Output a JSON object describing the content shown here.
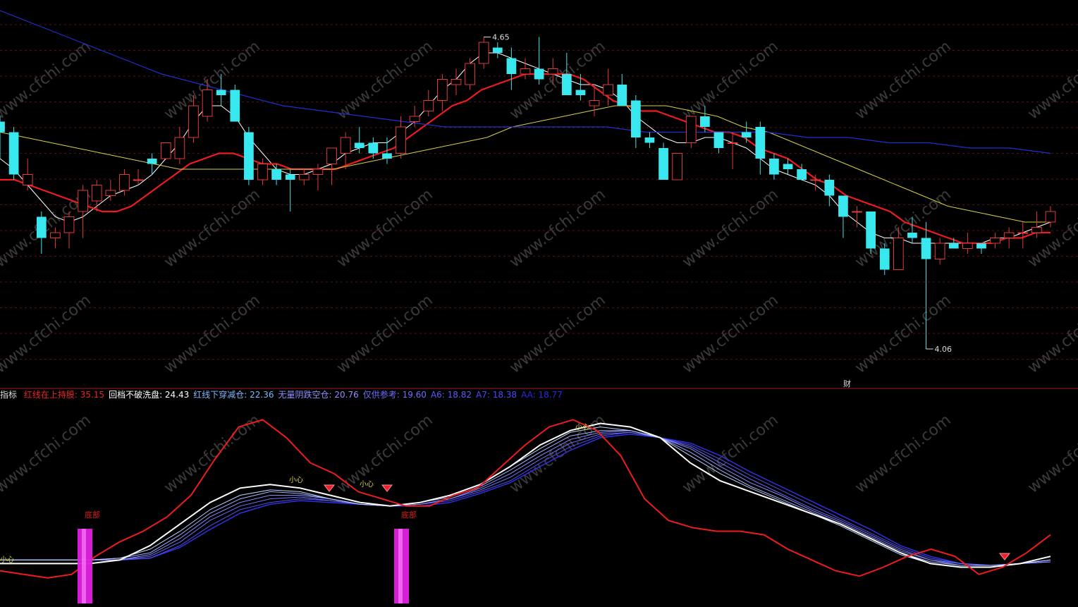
{
  "colors": {
    "background": "#000000",
    "up": "#e23a3a",
    "down": "#38e8ee",
    "ma_white": "#ffffff",
    "ma_red": "#ee1c1c",
    "ma_yellow": "#d6d040",
    "ma_blue": "#2030d0",
    "grid": "#5a1010",
    "divider": "#a02020",
    "bar_magenta": "#e020e0",
    "bottom_marker": "#ee2030"
  },
  "watermark": "www.cfchi.com",
  "price_panel": {
    "high_label": "4.65",
    "low_label": "4.06",
    "cai_label": "财"
  },
  "indicator_legend": {
    "name": "指标",
    "items": [
      {
        "label": "红线在上持股:",
        "value": "35.15",
        "color": "#ee2222"
      },
      {
        "label": "回档不破洗盘:",
        "value": "24.43",
        "color": "#ffffff"
      },
      {
        "label": "红线下穿减仓:",
        "value": "22.36",
        "color": "#7fb8ff"
      },
      {
        "label": "无量阴跌空仓:",
        "value": "20.76",
        "color": "#8f8fff"
      },
      {
        "label": "仅供参考:",
        "value": "19.60",
        "color": "#6f6fff"
      },
      {
        "label": "A6:",
        "value": "18.82",
        "color": "#5a5aff"
      },
      {
        "label": "A7:",
        "value": "18.38",
        "color": "#4a4aff"
      },
      {
        "label": "AA:",
        "value": "18.77",
        "color": "#2a2ae0"
      }
    ]
  },
  "indicator_panel": {
    "bottom_labels": [
      "底部",
      "底部"
    ],
    "small_marker_text": "小心"
  },
  "chart_data": [
    {
      "type": "candlestick",
      "title": "",
      "ylim": [
        4.0,
        4.7
      ],
      "max_marker": 4.65,
      "min_marker": 4.06,
      "candles": [
        {
          "o": 4.49,
          "h": 4.5,
          "l": 4.42,
          "c": 4.47
        },
        {
          "o": 4.47,
          "h": 4.48,
          "l": 4.38,
          "c": 4.39
        },
        {
          "o": 4.37,
          "h": 4.42,
          "l": 4.36,
          "c": 4.39
        },
        {
          "o": 4.31,
          "h": 4.32,
          "l": 4.24,
          "c": 4.27
        },
        {
          "o": 4.27,
          "h": 4.29,
          "l": 4.25,
          "c": 4.28
        },
        {
          "o": 4.28,
          "h": 4.32,
          "l": 4.25,
          "c": 4.31
        },
        {
          "o": 4.32,
          "h": 4.37,
          "l": 4.27,
          "c": 4.36
        },
        {
          "o": 4.34,
          "h": 4.38,
          "l": 4.32,
          "c": 4.37
        },
        {
          "o": 4.35,
          "h": 4.38,
          "l": 4.34,
          "c": 4.36
        },
        {
          "o": 4.36,
          "h": 4.4,
          "l": 4.35,
          "c": 4.39
        },
        {
          "o": 4.38,
          "h": 4.4,
          "l": 4.37,
          "c": 4.38
        },
        {
          "o": 4.42,
          "h": 4.43,
          "l": 4.39,
          "c": 4.41
        },
        {
          "o": 4.42,
          "h": 4.45,
          "l": 4.42,
          "c": 4.45
        },
        {
          "o": 4.42,
          "h": 4.48,
          "l": 4.41,
          "c": 4.46
        },
        {
          "o": 4.46,
          "h": 4.54,
          "l": 4.45,
          "c": 4.52
        },
        {
          "o": 4.5,
          "h": 4.57,
          "l": 4.49,
          "c": 4.55
        },
        {
          "o": 4.55,
          "h": 4.58,
          "l": 4.52,
          "c": 4.54
        },
        {
          "o": 4.55,
          "h": 4.56,
          "l": 4.51,
          "c": 4.49
        },
        {
          "o": 4.47,
          "h": 4.48,
          "l": 4.37,
          "c": 4.38
        },
        {
          "o": 4.38,
          "h": 4.42,
          "l": 4.37,
          "c": 4.41
        },
        {
          "o": 4.4,
          "h": 4.41,
          "l": 4.37,
          "c": 4.38
        },
        {
          "o": 4.39,
          "h": 4.4,
          "l": 4.32,
          "c": 4.38
        },
        {
          "o": 4.38,
          "h": 4.4,
          "l": 4.37,
          "c": 4.39
        },
        {
          "o": 4.39,
          "h": 4.41,
          "l": 4.36,
          "c": 4.4
        },
        {
          "o": 4.41,
          "h": 4.44,
          "l": 4.37,
          "c": 4.44
        },
        {
          "o": 4.43,
          "h": 4.47,
          "l": 4.4,
          "c": 4.46
        },
        {
          "o": 4.45,
          "h": 4.48,
          "l": 4.43,
          "c": 4.44
        },
        {
          "o": 4.45,
          "h": 4.46,
          "l": 4.42,
          "c": 4.43
        },
        {
          "o": 4.43,
          "h": 4.46,
          "l": 4.41,
          "c": 4.42
        },
        {
          "o": 4.43,
          "h": 4.5,
          "l": 4.42,
          "c": 4.48
        },
        {
          "o": 4.49,
          "h": 4.52,
          "l": 4.48,
          "c": 4.5
        },
        {
          "o": 4.51,
          "h": 4.55,
          "l": 4.5,
          "c": 4.53
        },
        {
          "o": 4.53,
          "h": 4.58,
          "l": 4.51,
          "c": 4.57
        },
        {
          "o": 4.56,
          "h": 4.59,
          "l": 4.54,
          "c": 4.57
        },
        {
          "o": 4.56,
          "h": 4.61,
          "l": 4.55,
          "c": 4.6
        },
        {
          "o": 4.6,
          "h": 4.65,
          "l": 4.59,
          "c": 4.64
        },
        {
          "o": 4.63,
          "h": 4.64,
          "l": 4.61,
          "c": 4.62
        },
        {
          "o": 4.61,
          "h": 4.63,
          "l": 4.55,
          "c": 4.58
        },
        {
          "o": 4.58,
          "h": 4.61,
          "l": 4.57,
          "c": 4.59
        },
        {
          "o": 4.59,
          "h": 4.65,
          "l": 4.56,
          "c": 4.57
        },
        {
          "o": 4.58,
          "h": 4.61,
          "l": 4.56,
          "c": 4.59
        },
        {
          "o": 4.58,
          "h": 4.62,
          "l": 4.55,
          "c": 4.54
        },
        {
          "o": 4.55,
          "h": 4.58,
          "l": 4.53,
          "c": 4.54
        },
        {
          "o": 4.52,
          "h": 4.56,
          "l": 4.5,
          "c": 4.53
        },
        {
          "o": 4.54,
          "h": 4.59,
          "l": 4.52,
          "c": 4.56
        },
        {
          "o": 4.56,
          "h": 4.58,
          "l": 4.52,
          "c": 4.52
        },
        {
          "o": 4.53,
          "h": 4.54,
          "l": 4.44,
          "c": 4.46
        },
        {
          "o": 4.46,
          "h": 4.47,
          "l": 4.44,
          "c": 4.45
        },
        {
          "o": 4.44,
          "h": 4.45,
          "l": 4.38,
          "c": 4.38
        },
        {
          "o": 4.38,
          "h": 4.43,
          "l": 4.38,
          "c": 4.43
        },
        {
          "o": 4.45,
          "h": 4.5,
          "l": 4.44,
          "c": 4.5
        },
        {
          "o": 4.5,
          "h": 4.52,
          "l": 4.47,
          "c": 4.48
        },
        {
          "o": 4.47,
          "h": 4.47,
          "l": 4.43,
          "c": 4.44
        },
        {
          "o": 4.45,
          "h": 4.47,
          "l": 4.4,
          "c": 4.45
        },
        {
          "o": 4.47,
          "h": 4.49,
          "l": 4.45,
          "c": 4.46
        },
        {
          "o": 4.48,
          "h": 4.49,
          "l": 4.39,
          "c": 4.42
        },
        {
          "o": 4.42,
          "h": 4.43,
          "l": 4.38,
          "c": 4.39
        },
        {
          "o": 4.41,
          "h": 4.42,
          "l": 4.39,
          "c": 4.4
        },
        {
          "o": 4.4,
          "h": 4.41,
          "l": 4.38,
          "c": 4.38
        },
        {
          "o": 4.38,
          "h": 4.39,
          "l": 4.36,
          "c": 4.38
        },
        {
          "o": 4.38,
          "h": 4.39,
          "l": 4.33,
          "c": 4.35
        },
        {
          "o": 4.35,
          "h": 4.35,
          "l": 4.27,
          "c": 4.31
        },
        {
          "o": 4.32,
          "h": 4.33,
          "l": 4.29,
          "c": 4.32
        },
        {
          "o": 4.32,
          "h": 4.32,
          "l": 4.24,
          "c": 4.25
        },
        {
          "o": 4.25,
          "h": 4.26,
          "l": 4.2,
          "c": 4.21
        },
        {
          "o": 4.21,
          "h": 4.29,
          "l": 4.21,
          "c": 4.27
        },
        {
          "o": 4.28,
          "h": 4.31,
          "l": 4.26,
          "c": 4.27
        },
        {
          "o": 4.27,
          "h": 4.3,
          "l": 4.06,
          "c": 4.23
        },
        {
          "o": 4.23,
          "h": 4.27,
          "l": 4.22,
          "c": 4.26
        },
        {
          "o": 4.26,
          "h": 4.27,
          "l": 4.25,
          "c": 4.25
        },
        {
          "o": 4.25,
          "h": 4.28,
          "l": 4.24,
          "c": 4.26
        },
        {
          "o": 4.26,
          "h": 4.26,
          "l": 4.24,
          "c": 4.25
        },
        {
          "o": 4.26,
          "h": 4.28,
          "l": 4.25,
          "c": 4.27
        },
        {
          "o": 4.27,
          "h": 4.29,
          "l": 4.25,
          "c": 4.28
        },
        {
          "o": 4.28,
          "h": 4.3,
          "l": 4.25,
          "c": 4.28
        },
        {
          "o": 4.28,
          "h": 4.32,
          "l": 4.27,
          "c": 4.29
        },
        {
          "o": 4.3,
          "h": 4.33,
          "l": 4.29,
          "c": 4.32
        }
      ],
      "series": [
        {
          "kind": "ma_white",
          "values": [
            4.42,
            4.4,
            4.37,
            4.34,
            4.31,
            4.3,
            4.31,
            4.33,
            4.35,
            4.36,
            4.37,
            4.39,
            4.42,
            4.45,
            4.49,
            4.52,
            4.52,
            4.5,
            4.46,
            4.43,
            4.4,
            4.39,
            4.39,
            4.4,
            4.41,
            4.43,
            4.44,
            4.45,
            4.45,
            4.47,
            4.49,
            4.52,
            4.55,
            4.57,
            4.6,
            4.62,
            4.62,
            4.61,
            4.6,
            4.59,
            4.58,
            4.57,
            4.56,
            4.56,
            4.55,
            4.53,
            4.5,
            4.48,
            4.46,
            4.45,
            4.45,
            4.46,
            4.46,
            4.45,
            4.44,
            4.42,
            4.4,
            4.39,
            4.38,
            4.37,
            4.35,
            4.32,
            4.3,
            4.28,
            4.27,
            4.27,
            4.26,
            4.26,
            4.26,
            4.26,
            4.26,
            4.26,
            4.27,
            4.27,
            4.28,
            4.29,
            4.3
          ]
        },
        {
          "kind": "ma_red",
          "values": [
            4.38,
            4.38,
            4.37,
            4.36,
            4.35,
            4.34,
            4.33,
            4.32,
            4.32,
            4.33,
            4.35,
            4.37,
            4.39,
            4.41,
            4.42,
            4.43,
            4.43,
            4.42,
            4.41,
            4.41,
            4.4,
            4.4,
            4.4,
            4.4,
            4.41,
            4.42,
            4.43,
            4.44,
            4.46,
            4.48,
            4.5,
            4.52,
            4.53,
            4.55,
            4.56,
            4.57,
            4.58,
            4.58,
            4.58,
            4.58,
            4.57,
            4.55,
            4.53,
            4.52,
            4.51,
            4.51,
            4.5,
            4.49,
            4.48,
            4.47,
            4.47,
            4.46,
            4.44,
            4.43,
            4.42,
            4.4,
            4.38,
            4.37,
            4.35,
            4.34,
            4.33,
            4.32,
            4.3,
            4.29,
            4.28,
            4.27,
            4.26,
            4.26,
            4.26,
            4.27,
            4.27,
            4.28,
            4.28
          ]
        },
        {
          "kind": "ma_yellow",
          "values": [
            4.47,
            4.46,
            4.45,
            4.44,
            4.43,
            4.42,
            4.41,
            4.4,
            4.4,
            4.4,
            4.4,
            4.4,
            4.4,
            4.4,
            4.41,
            4.42,
            4.43,
            4.44,
            4.45,
            4.46,
            4.48,
            4.49,
            4.5,
            4.51,
            4.52,
            4.52,
            4.52,
            4.51,
            4.5,
            4.48,
            4.47,
            4.45,
            4.43,
            4.41,
            4.39,
            4.37,
            4.35,
            4.33,
            4.32,
            4.31,
            4.3,
            4.3
          ]
        },
        {
          "kind": "ma_blue",
          "values": [
            4.7,
            4.67,
            4.64,
            4.61,
            4.58,
            4.56,
            4.54,
            4.52,
            4.51,
            4.5,
            4.49,
            4.48,
            4.48,
            4.48,
            4.48,
            4.48,
            4.47,
            4.47,
            4.47,
            4.47,
            4.46,
            4.46,
            4.45,
            4.45,
            4.44,
            4.44,
            4.43
          ]
        }
      ]
    },
    {
      "type": "line",
      "title": "",
      "ylim": [
        0,
        100
      ],
      "series": [
        {
          "name": "红线在上持股",
          "values": [
            8,
            6,
            4,
            6,
            16,
            24,
            30,
            38,
            50,
            70,
            88,
            92,
            82,
            68,
            62,
            52,
            48,
            44,
            44,
            50,
            54,
            66,
            78,
            88,
            92,
            86,
            72,
            48,
            36,
            32,
            30,
            30,
            28,
            20,
            14,
            8,
            5,
            10,
            16,
            20,
            16,
            6,
            10,
            18,
            28
          ]
        },
        {
          "name": "回档不破洗盘",
          "values": [
            12,
            12,
            12,
            12,
            14,
            22,
            34,
            46,
            54,
            56,
            54,
            50,
            46,
            44,
            46,
            50,
            56,
            66,
            78,
            86,
            90,
            88,
            82,
            68,
            58,
            52,
            46,
            40,
            34,
            26,
            18,
            12,
            10,
            10,
            12,
            16
          ]
        },
        {
          "name": "红线下穿减仓",
          "values": [
            14,
            14,
            14,
            14,
            15,
            20,
            30,
            42,
            50,
            53,
            52,
            48,
            45,
            44,
            46,
            50,
            56,
            66,
            76,
            85,
            88,
            86,
            82,
            72,
            62,
            54,
            47,
            40,
            33,
            25,
            17,
            12,
            10,
            10,
            12,
            14
          ]
        },
        {
          "name": "无量阴跌空仓",
          "values": [
            14,
            14,
            14,
            14,
            15,
            18,
            28,
            40,
            48,
            52,
            51,
            48,
            45,
            44,
            46,
            49,
            55,
            64,
            74,
            83,
            86,
            86,
            82,
            74,
            64,
            55,
            48,
            41,
            34,
            26,
            18,
            13,
            11,
            11,
            12,
            14
          ]
        },
        {
          "name": "仅供参考",
          "values": [
            14,
            14,
            14,
            14,
            14,
            17,
            26,
            38,
            46,
            50,
            50,
            48,
            45,
            44,
            45,
            48,
            54,
            62,
            72,
            81,
            85,
            86,
            82,
            76,
            66,
            57,
            50,
            42,
            35,
            27,
            19,
            14,
            11,
            11,
            12,
            13
          ]
        },
        {
          "name": "A6",
          "values": [
            14,
            14,
            14,
            14,
            14,
            16,
            24,
            36,
            44,
            48,
            49,
            47,
            45,
            44,
            45,
            48,
            53,
            60,
            70,
            79,
            84,
            85,
            82,
            77,
            68,
            59,
            51,
            43,
            36,
            28,
            20,
            14,
            12,
            11,
            12,
            13
          ]
        },
        {
          "name": "A7",
          "values": [
            14,
            14,
            14,
            14,
            14,
            15,
            22,
            33,
            42,
            46,
            48,
            47,
            45,
            44,
            45,
            47,
            52,
            58,
            68,
            77,
            83,
            85,
            82,
            78,
            70,
            61,
            53,
            45,
            37,
            29,
            21,
            15,
            12,
            11,
            12,
            13
          ]
        },
        {
          "name": "AA",
          "values": [
            14,
            14,
            14,
            14,
            14,
            15,
            21,
            31,
            40,
            45,
            47,
            46,
            45,
            44,
            44,
            46,
            51,
            57,
            66,
            75,
            82,
            84,
            82,
            79,
            72,
            63,
            55,
            47,
            39,
            31,
            22,
            16,
            12,
            11,
            12,
            13
          ]
        }
      ]
    }
  ]
}
